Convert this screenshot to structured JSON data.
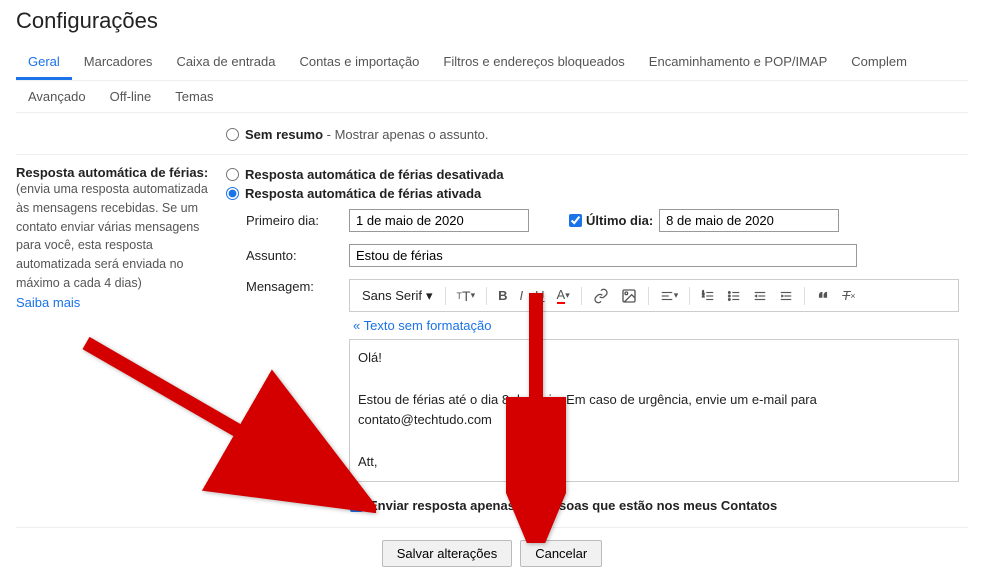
{
  "page_title": "Configurações",
  "tabs": {
    "row1": [
      "Geral",
      "Marcadores",
      "Caixa de entrada",
      "Contas e importação",
      "Filtros e endereços bloqueados",
      "Encaminhamento e POP/IMAP",
      "Complem"
    ],
    "row2": [
      "Avançado",
      "Off-line",
      "Temas"
    ]
  },
  "summary": {
    "radio_label": "Sem resumo",
    "radio_desc": " - Mostrar apenas o assunto."
  },
  "vacation": {
    "section_title": "Resposta automática de férias:",
    "section_desc": "(envia uma resposta automatizada às mensagens recebidas. Se um contato enviar várias mensagens para você, esta resposta automatizada será enviada no máximo a cada 4 dias)",
    "learn_more": "Saiba mais",
    "radio_off": "Resposta automática de férias desativada",
    "radio_on": "Resposta automática de férias ativada",
    "first_day_label": "Primeiro dia:",
    "first_day_value": "1 de maio de 2020",
    "last_day_label": "Último dia:",
    "last_day_value": "8 de maio de 2020",
    "subject_label": "Assunto:",
    "subject_value": "Estou de férias",
    "message_label": "Mensagem:",
    "font_name": "Sans Serif",
    "plain_text_link": "« Texto sem formatação",
    "message_body_line1": "Olá!",
    "message_body_line2": "Estou de férias até o dia 8 de maio. Em caso de urgência, envie um e-mail para contato@techtudo.com",
    "message_body_line3": "Att,",
    "contacts_only": "Enviar resposta apenas às pessoas que estão nos meus Contatos"
  },
  "footer": {
    "save": "Salvar alterações",
    "cancel": "Cancelar"
  }
}
